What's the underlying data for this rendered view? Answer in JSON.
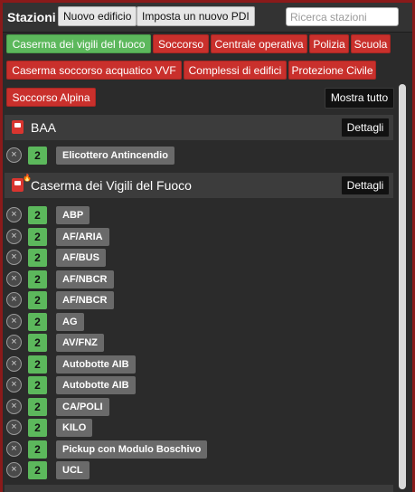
{
  "header": {
    "title": "Stazioni",
    "new_building": "Nuovo edificio",
    "set_poi": "Imposta un nuovo PDI",
    "search_placeholder": "Ricerca stazioni"
  },
  "filters": [
    {
      "label": "Caserma dei vigili del fuoco",
      "active": true
    },
    {
      "label": "Soccorso",
      "active": false
    },
    {
      "label": "Centrale operativa",
      "active": false
    },
    {
      "label": "Polizia",
      "active": false
    },
    {
      "label": "Scuola",
      "active": false
    },
    {
      "label": "Caserma soccorso acquatico VVF",
      "active": false
    },
    {
      "label": "Complessi di edifici",
      "active": false
    },
    {
      "label": "Protezione Civile",
      "active": false
    },
    {
      "label": "Soccorso Alpina",
      "active": false
    }
  ],
  "show_all": "Mostra tutto",
  "colors": {
    "active_filter": "#5cb85c",
    "inactive_filter": "#c9302c",
    "status": "#5cb85c"
  },
  "stations": [
    {
      "name": "BAA",
      "icon": "station-marker-icon",
      "details": "Dettagli",
      "vehicles": [
        {
          "status": "2",
          "name": "Elicottero Antincendio"
        }
      ]
    },
    {
      "name": "Caserma dei Vigili del Fuoco",
      "icon": "fire-station-icon",
      "details": "Dettagli",
      "vehicles": [
        {
          "status": "2",
          "name": "ABP"
        },
        {
          "status": "2",
          "name": "AF/ARIA"
        },
        {
          "status": "2",
          "name": "AF/BUS"
        },
        {
          "status": "2",
          "name": "AF/NBCR"
        },
        {
          "status": "2",
          "name": "AF/NBCR"
        },
        {
          "status": "2",
          "name": "AG"
        },
        {
          "status": "2",
          "name": "AV/FNZ"
        },
        {
          "status": "2",
          "name": "Autobotte AIB"
        },
        {
          "status": "2",
          "name": "Autobotte AIB"
        },
        {
          "status": "2",
          "name": "CA/POLI"
        },
        {
          "status": "2",
          "name": "KILO"
        },
        {
          "status": "2",
          "name": "Pickup con Modulo Boschivo"
        },
        {
          "status": "2",
          "name": "UCL"
        }
      ]
    }
  ]
}
